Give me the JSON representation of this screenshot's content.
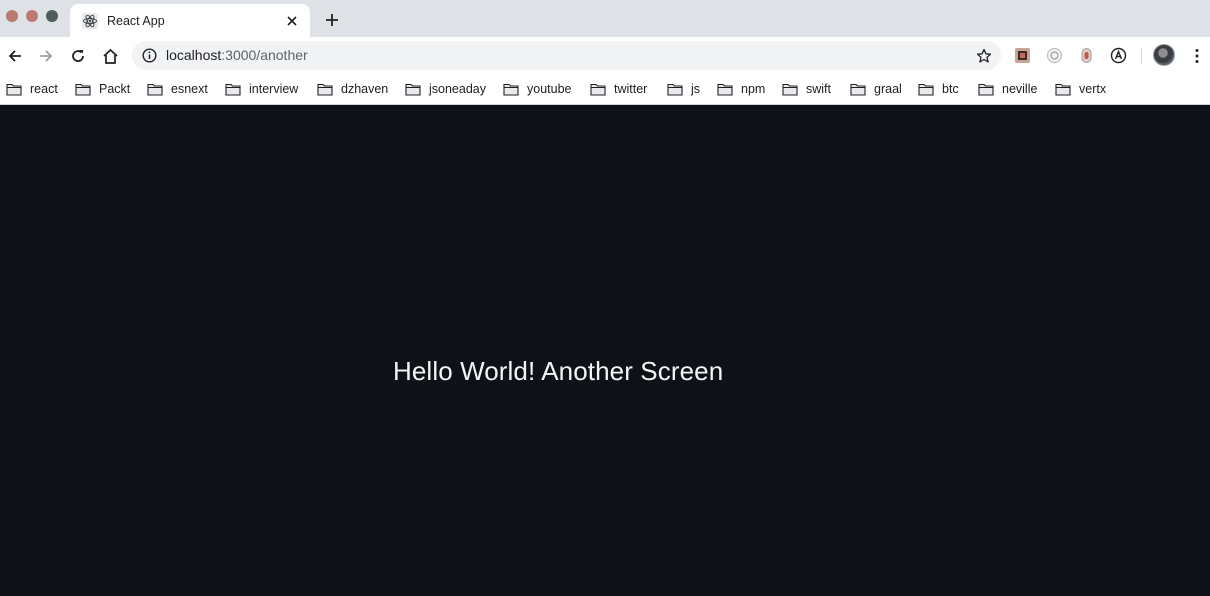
{
  "window": {
    "traffic_lights": [
      "close",
      "minimize",
      "maximize"
    ]
  },
  "tab": {
    "title": "React App",
    "favicon": "react-atom-icon"
  },
  "toolbar": {
    "url_host": "localhost",
    "url_path": ":3000/another",
    "extensions": [
      "extension-1-icon",
      "extension-2-icon",
      "extension-3-icon",
      "extension-4-icon"
    ]
  },
  "bookmarks": [
    {
      "label": "react"
    },
    {
      "label": "Packt"
    },
    {
      "label": "esnext"
    },
    {
      "label": "interview"
    },
    {
      "label": "dzhaven"
    },
    {
      "label": "jsoneaday"
    },
    {
      "label": "youtube"
    },
    {
      "label": "twitter"
    },
    {
      "label": "js"
    },
    {
      "label": "npm"
    },
    {
      "label": "swift"
    },
    {
      "label": "graal"
    },
    {
      "label": "btc"
    },
    {
      "label": "neville"
    },
    {
      "label": "vertx"
    }
  ],
  "page": {
    "heading": "Hello World! Another Screen",
    "background_color": "#0e1117",
    "text_color": "#f5f5f5"
  }
}
